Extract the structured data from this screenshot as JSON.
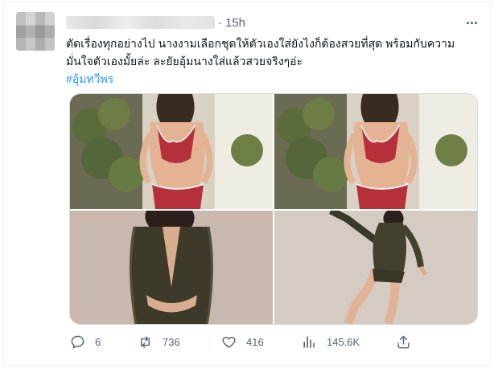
{
  "tweet": {
    "time": "15h",
    "separator": "·",
    "text_line1": "ตัดเรื่องทุกอย่างไป นางงามเลือกชุดให้ตัวเองใส่ยังไงก็ต้องสวยที่สุด พร้อมกับความ",
    "text_line2": "มั่นใจตัวเองมั้ยล่ะ ละยัยอุ้มนางใส่แล้วสวยจริงๆอ่ะ",
    "hashtag": "#อุ้มทวีพร"
  },
  "actions": {
    "replies": "6",
    "retweets": "736",
    "likes": "416",
    "views": "145.6K"
  },
  "icons": [
    "more-icon",
    "reply-icon",
    "retweet-icon",
    "like-icon",
    "views-icon",
    "share-icon"
  ],
  "colors": {
    "link": "#1d9bf0",
    "secondary": "#536471",
    "text": "#0f1419"
  }
}
